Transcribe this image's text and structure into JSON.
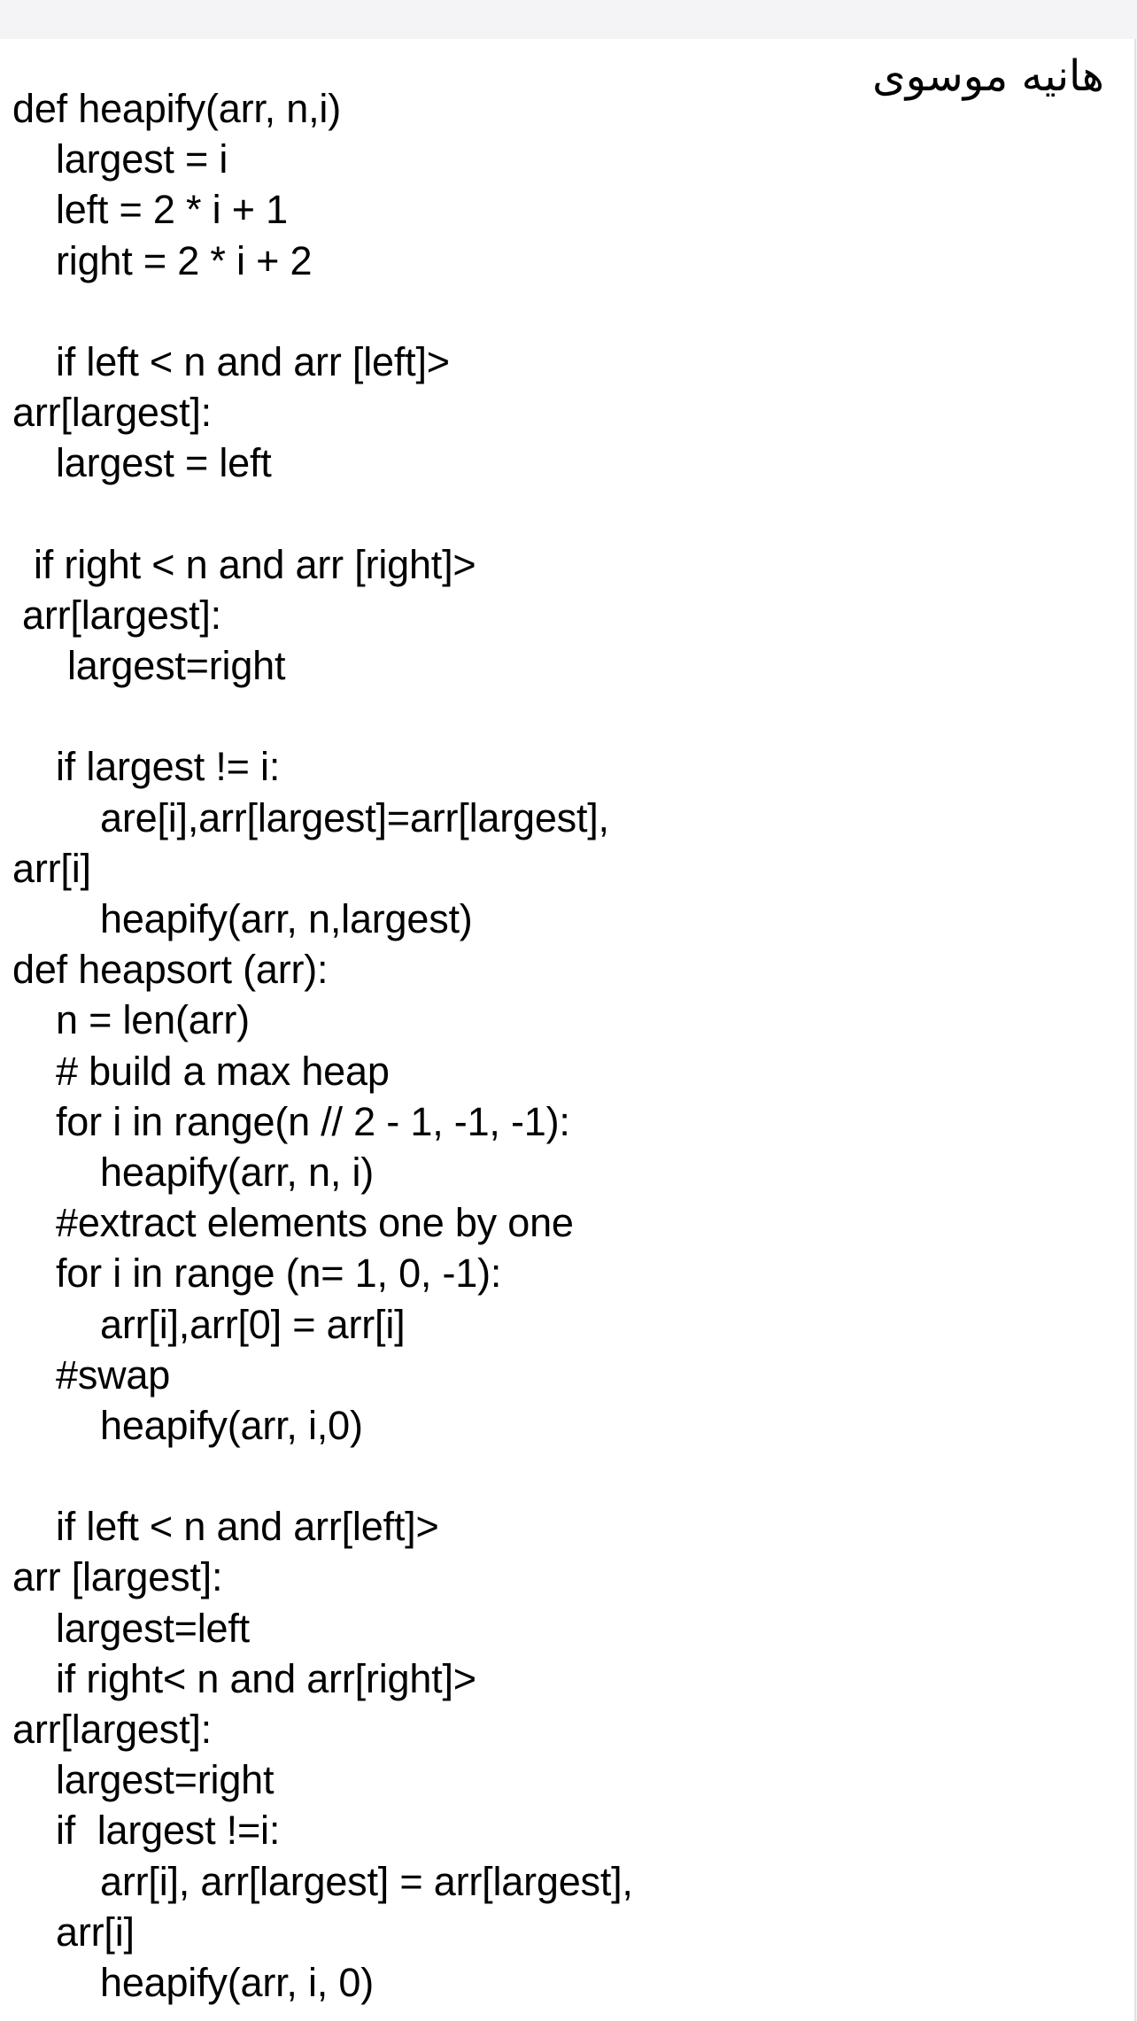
{
  "note": {
    "author": "هانیه موسوی",
    "lines": [
      "def heapify(arr, n,i)",
      "largest = i",
      "left = 2 * i + 1",
      "right = 2 * i + 2",
      "",
      "if left < n and arr [left]>",
      "arr[largest]:",
      "largest = left",
      "",
      "if right < n and arr [right]>",
      "arr[largest]:",
      "largest=right",
      "",
      "if largest != i:",
      "are[i],arr[largest]=arr[largest],",
      "arr[i]",
      "heapify(arr, n,largest)",
      "def heapsort (arr):",
      "n = len(arr)",
      "# build a max heap",
      "for i in range(n // 2 - 1, -1, -1):",
      "heapify(arr, n, i)",
      "#extract elements one by one",
      "for i in range (n= 1, 0, -1):",
      "arr[i],arr[0] = arr[i]",
      "#swap",
      "heapify(arr, i,0)",
      "",
      "if left < n and arr[left]>",
      "arr [largest]:",
      "largest=left",
      "if right< n and arr[right]>",
      "arr[largest]:",
      "largest=right",
      "if  largest !=i:",
      "arr[i], arr[largest] = arr[largest],",
      "arr[i]",
      "heapify(arr, i, 0)"
    ]
  }
}
